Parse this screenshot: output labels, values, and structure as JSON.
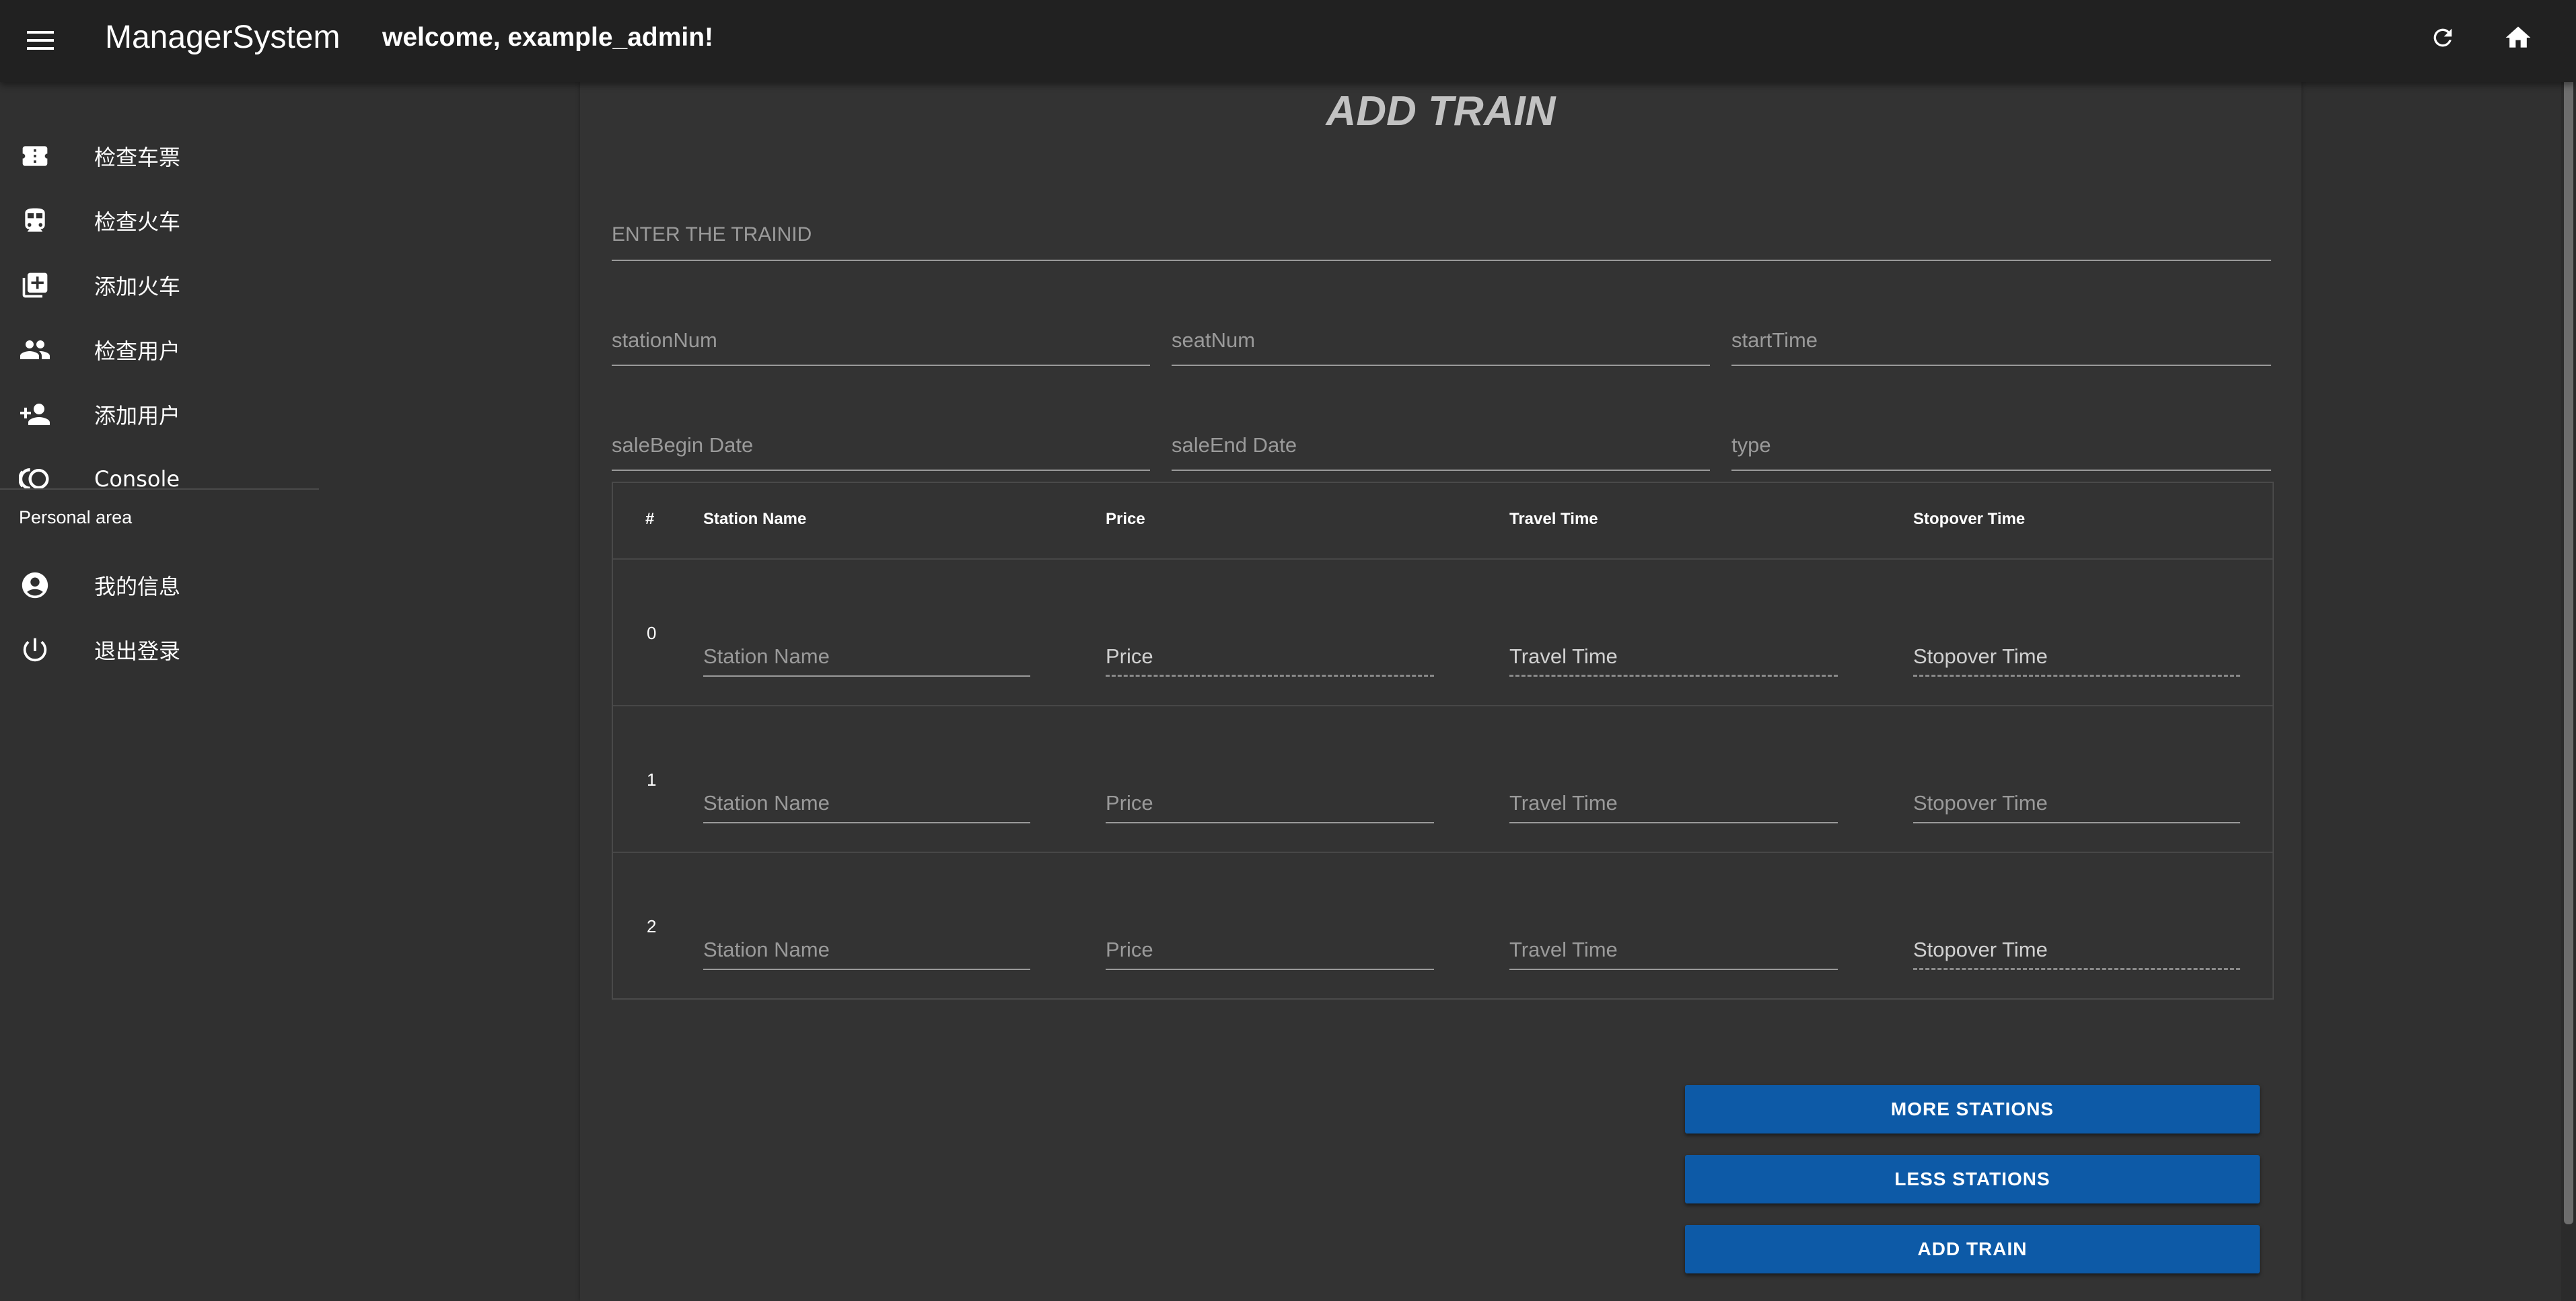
{
  "appbar": {
    "title": "ManagerSystem",
    "welcome": "welcome, example_admin!",
    "icons": {
      "menu": "menu-icon",
      "refresh": "refresh-icon",
      "home": "home-icon"
    }
  },
  "sidebar": {
    "items": [
      {
        "label": "检查车票",
        "icon": "ticket-icon"
      },
      {
        "label": "检查火车",
        "icon": "train-icon"
      },
      {
        "label": "添加火车",
        "icon": "library-add-icon"
      },
      {
        "label": "检查用户",
        "icon": "people-icon"
      },
      {
        "label": "添加用户",
        "icon": "person-add-icon"
      },
      {
        "label": "Console",
        "icon": "console-icon"
      }
    ],
    "personal_header": "Personal area",
    "personal_items": [
      {
        "label": "我的信息",
        "icon": "account-circle-icon"
      },
      {
        "label": "退出登录",
        "icon": "power-icon"
      }
    ]
  },
  "form": {
    "title": "ADD TRAIN",
    "trainid_placeholder": "ENTER THE TRAINID",
    "station_num_placeholder": "stationNum",
    "seat_num_placeholder": "seatNum",
    "start_time_placeholder": "startTime",
    "sale_begin_placeholder": "saleBegin Date",
    "sale_end_placeholder": "saleEnd Date",
    "type_placeholder": "type"
  },
  "table": {
    "headers": [
      "#",
      "Station Name",
      "Price",
      "Travel Time",
      "Stopover Time"
    ],
    "rows": [
      {
        "index": "0",
        "station": "Station Name",
        "price": "Price",
        "travel": "Travel Time",
        "stopover": "Stopover Time"
      },
      {
        "index": "1",
        "station": "Station Name",
        "price": "Price",
        "travel": "Travel Time",
        "stopover": "Stopover Time"
      },
      {
        "index": "2",
        "station": "Station Name",
        "price": "Price",
        "travel": "Travel Time",
        "stopover": "Stopover Time"
      }
    ]
  },
  "buttons": {
    "more_stations": "MORE STATIONS",
    "less_stations": "LESS STATIONS",
    "add_train": "ADD TRAIN"
  },
  "colors": {
    "appbar": "#212121",
    "background": "#303030",
    "card": "#333333",
    "button": "#0d5aa7"
  }
}
